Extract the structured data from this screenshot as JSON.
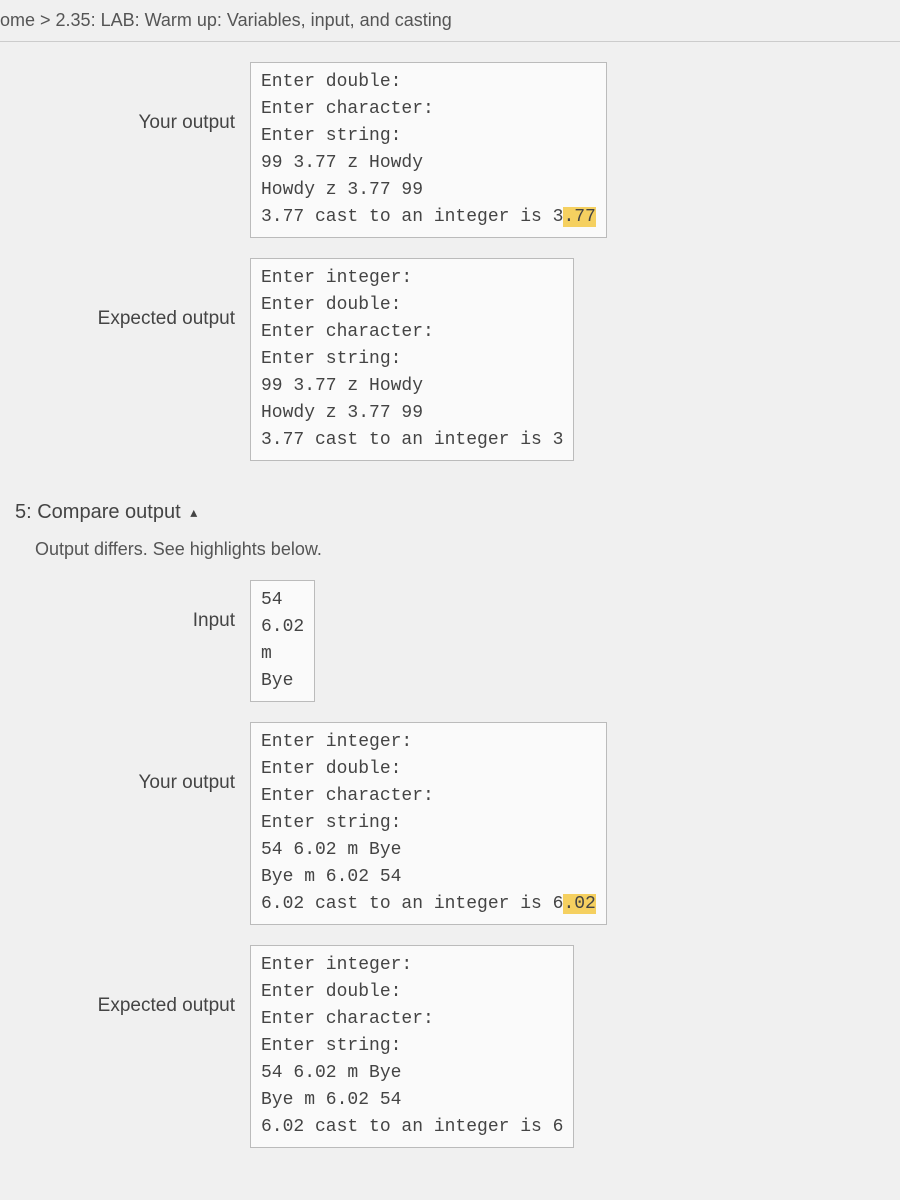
{
  "breadcrumb": "ome > 2.35: LAB: Warm up: Variables, input, and casting",
  "block1": {
    "your_output_label": "Your output",
    "your_output_pre": "Enter double:\nEnter character:\nEnter string:\n99 3.77 z Howdy\nHowdy z 3.77 99\n3.77 cast to an integer is 3",
    "your_output_hl": ".77",
    "expected_output_label": "Expected output",
    "expected_output": "Enter integer:\nEnter double:\nEnter character:\nEnter string:\n99 3.77 z Howdy\nHowdy z 3.77 99\n3.77 cast to an integer is 3"
  },
  "section5": {
    "title": "5: Compare output",
    "subtitle": "Output differs. See highlights below.",
    "input_label": "Input",
    "input": "54\n6.02\nm\nBye",
    "your_output_label": "Your output",
    "your_output_pre": "Enter integer:\nEnter double:\nEnter character:\nEnter string:\n54 6.02 m Bye\nBye m 6.02 54\n6.02 cast to an integer is 6",
    "your_output_hl": ".02",
    "expected_output_label": "Expected output",
    "expected_output": "Enter integer:\nEnter double:\nEnter character:\nEnter string:\n54 6.02 m Bye\nBye m 6.02 54\n6.02 cast to an integer is 6"
  }
}
